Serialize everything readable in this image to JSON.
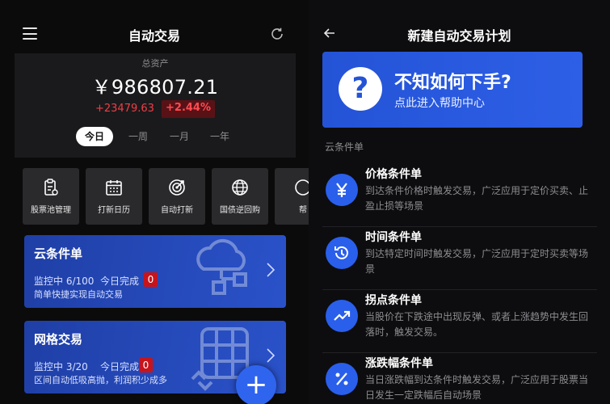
{
  "left": {
    "title": "自动交易",
    "asset": {
      "label": "总资产",
      "value": "￥986807.21",
      "change_abs": "+23479.63",
      "change_pct": "+2.44%"
    },
    "periods": [
      "今日",
      "一周",
      "一月",
      "一年"
    ],
    "active_period": "今日",
    "tiles": [
      {
        "label": "股票池管理",
        "icon": "clipboard-icon"
      },
      {
        "label": "打新日历",
        "icon": "calendar-icon"
      },
      {
        "label": "自动打新",
        "icon": "target-icon"
      },
      {
        "label": "国债逆回购",
        "icon": "globe-icon"
      },
      {
        "label": "帮",
        "icon": "help-icon"
      }
    ],
    "cards": [
      {
        "title": "云条件单",
        "monitor": "监控中 6/100",
        "done_label": "今日完成",
        "done_count": "0",
        "desc": "简单快捷实现自动交易"
      },
      {
        "title": "网格交易",
        "monitor": "监控中 3/20",
        "done_label": "今日完成",
        "done_count": "0",
        "desc": "区间自动低吸高抛，利润积少成多"
      }
    ],
    "fab_label": "+"
  },
  "right": {
    "title": "新建自动交易计划",
    "help": {
      "icon": "?",
      "title": "不知如何下手?",
      "subtitle": "点此进入帮助中心"
    },
    "section": "云条件单",
    "items": [
      {
        "title": "价格条件单",
        "desc": "到达条件价格时触发交易，广泛应用于定价买卖、止盈止损等场景",
        "icon": "yen-icon"
      },
      {
        "title": "时间条件单",
        "desc": "到达特定时间时触发交易，广泛应用于定时买卖等场景",
        "icon": "clock-icon"
      },
      {
        "title": "拐点条件单",
        "desc": "当股价在下跌途中出现反弹、或者上涨趋势中发生回落时，触发交易。",
        "icon": "trend-icon"
      },
      {
        "title": "涨跌幅条件单",
        "desc": "当日涨跌幅到达条件时触发交易，广泛应用于股票当日发生一定跌幅后自动场景",
        "icon": "percent-icon"
      }
    ]
  },
  "colors": {
    "accent": "#2a5fec",
    "up": "#ef3e45",
    "card": "#2547b8"
  }
}
